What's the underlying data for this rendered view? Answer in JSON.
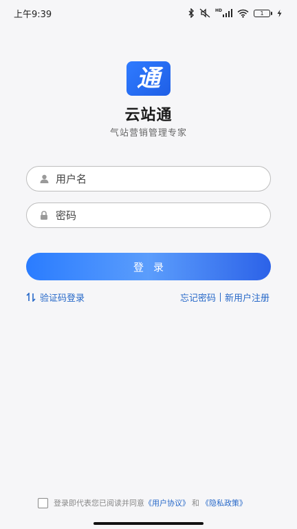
{
  "status_bar": {
    "time": "上午9:39",
    "icons": [
      "bluetooth-icon",
      "silent-icon",
      "hd-signal-icon",
      "wifi-icon",
      "battery-icon",
      "charging-icon"
    ],
    "hd_label": "HD",
    "battery_level": "1"
  },
  "app": {
    "logo_icon": "tong-logo-icon",
    "logo_char": "通",
    "name": "云站通",
    "slogan": "气站营销管理专家",
    "brand_color": "#1f5fe6"
  },
  "form": {
    "username_placeholder": "用户名",
    "password_placeholder": "密码",
    "login_label": "登录"
  },
  "links": {
    "sms_login": "验证码登录",
    "forgot_password": "忘记密码",
    "register": "新用户注册",
    "link_color": "#2668c8"
  },
  "agreement": {
    "prefix": "登录即代表您已阅读并同意",
    "user_agreement": "《用户协议》",
    "and": "和",
    "privacy_policy": "《隐私政策》"
  }
}
